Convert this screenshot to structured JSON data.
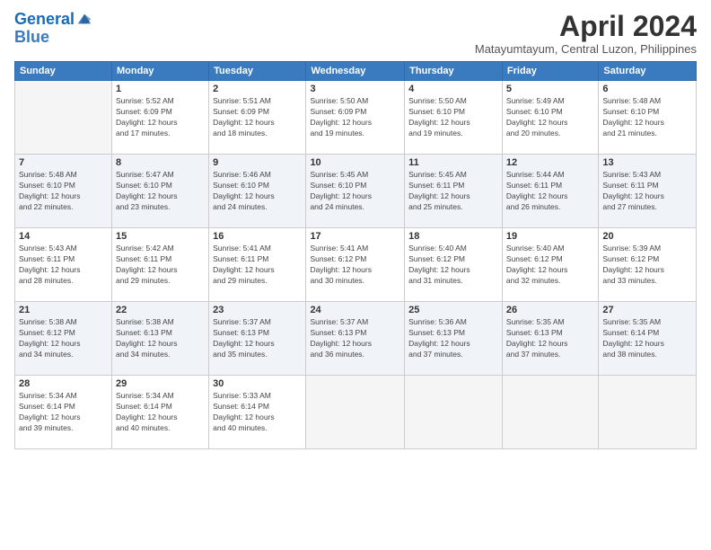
{
  "logo": {
    "line1": "General",
    "line2": "Blue"
  },
  "title": "April 2024",
  "location": "Matayumtayum, Central Luzon, Philippines",
  "days_of_week": [
    "Sunday",
    "Monday",
    "Tuesday",
    "Wednesday",
    "Thursday",
    "Friday",
    "Saturday"
  ],
  "weeks": [
    [
      {
        "day": "",
        "info": ""
      },
      {
        "day": "1",
        "info": "Sunrise: 5:52 AM\nSunset: 6:09 PM\nDaylight: 12 hours\nand 17 minutes."
      },
      {
        "day": "2",
        "info": "Sunrise: 5:51 AM\nSunset: 6:09 PM\nDaylight: 12 hours\nand 18 minutes."
      },
      {
        "day": "3",
        "info": "Sunrise: 5:50 AM\nSunset: 6:09 PM\nDaylight: 12 hours\nand 19 minutes."
      },
      {
        "day": "4",
        "info": "Sunrise: 5:50 AM\nSunset: 6:10 PM\nDaylight: 12 hours\nand 19 minutes."
      },
      {
        "day": "5",
        "info": "Sunrise: 5:49 AM\nSunset: 6:10 PM\nDaylight: 12 hours\nand 20 minutes."
      },
      {
        "day": "6",
        "info": "Sunrise: 5:48 AM\nSunset: 6:10 PM\nDaylight: 12 hours\nand 21 minutes."
      }
    ],
    [
      {
        "day": "7",
        "info": "Sunrise: 5:48 AM\nSunset: 6:10 PM\nDaylight: 12 hours\nand 22 minutes."
      },
      {
        "day": "8",
        "info": "Sunrise: 5:47 AM\nSunset: 6:10 PM\nDaylight: 12 hours\nand 23 minutes."
      },
      {
        "day": "9",
        "info": "Sunrise: 5:46 AM\nSunset: 6:10 PM\nDaylight: 12 hours\nand 24 minutes."
      },
      {
        "day": "10",
        "info": "Sunrise: 5:45 AM\nSunset: 6:10 PM\nDaylight: 12 hours\nand 24 minutes."
      },
      {
        "day": "11",
        "info": "Sunrise: 5:45 AM\nSunset: 6:11 PM\nDaylight: 12 hours\nand 25 minutes."
      },
      {
        "day": "12",
        "info": "Sunrise: 5:44 AM\nSunset: 6:11 PM\nDaylight: 12 hours\nand 26 minutes."
      },
      {
        "day": "13",
        "info": "Sunrise: 5:43 AM\nSunset: 6:11 PM\nDaylight: 12 hours\nand 27 minutes."
      }
    ],
    [
      {
        "day": "14",
        "info": "Sunrise: 5:43 AM\nSunset: 6:11 PM\nDaylight: 12 hours\nand 28 minutes."
      },
      {
        "day": "15",
        "info": "Sunrise: 5:42 AM\nSunset: 6:11 PM\nDaylight: 12 hours\nand 29 minutes."
      },
      {
        "day": "16",
        "info": "Sunrise: 5:41 AM\nSunset: 6:11 PM\nDaylight: 12 hours\nand 29 minutes."
      },
      {
        "day": "17",
        "info": "Sunrise: 5:41 AM\nSunset: 6:12 PM\nDaylight: 12 hours\nand 30 minutes."
      },
      {
        "day": "18",
        "info": "Sunrise: 5:40 AM\nSunset: 6:12 PM\nDaylight: 12 hours\nand 31 minutes."
      },
      {
        "day": "19",
        "info": "Sunrise: 5:40 AM\nSunset: 6:12 PM\nDaylight: 12 hours\nand 32 minutes."
      },
      {
        "day": "20",
        "info": "Sunrise: 5:39 AM\nSunset: 6:12 PM\nDaylight: 12 hours\nand 33 minutes."
      }
    ],
    [
      {
        "day": "21",
        "info": "Sunrise: 5:38 AM\nSunset: 6:12 PM\nDaylight: 12 hours\nand 34 minutes."
      },
      {
        "day": "22",
        "info": "Sunrise: 5:38 AM\nSunset: 6:13 PM\nDaylight: 12 hours\nand 34 minutes."
      },
      {
        "day": "23",
        "info": "Sunrise: 5:37 AM\nSunset: 6:13 PM\nDaylight: 12 hours\nand 35 minutes."
      },
      {
        "day": "24",
        "info": "Sunrise: 5:37 AM\nSunset: 6:13 PM\nDaylight: 12 hours\nand 36 minutes."
      },
      {
        "day": "25",
        "info": "Sunrise: 5:36 AM\nSunset: 6:13 PM\nDaylight: 12 hours\nand 37 minutes."
      },
      {
        "day": "26",
        "info": "Sunrise: 5:35 AM\nSunset: 6:13 PM\nDaylight: 12 hours\nand 37 minutes."
      },
      {
        "day": "27",
        "info": "Sunrise: 5:35 AM\nSunset: 6:14 PM\nDaylight: 12 hours\nand 38 minutes."
      }
    ],
    [
      {
        "day": "28",
        "info": "Sunrise: 5:34 AM\nSunset: 6:14 PM\nDaylight: 12 hours\nand 39 minutes."
      },
      {
        "day": "29",
        "info": "Sunrise: 5:34 AM\nSunset: 6:14 PM\nDaylight: 12 hours\nand 40 minutes."
      },
      {
        "day": "30",
        "info": "Sunrise: 5:33 AM\nSunset: 6:14 PM\nDaylight: 12 hours\nand 40 minutes."
      },
      {
        "day": "",
        "info": ""
      },
      {
        "day": "",
        "info": ""
      },
      {
        "day": "",
        "info": ""
      },
      {
        "day": "",
        "info": ""
      }
    ]
  ]
}
